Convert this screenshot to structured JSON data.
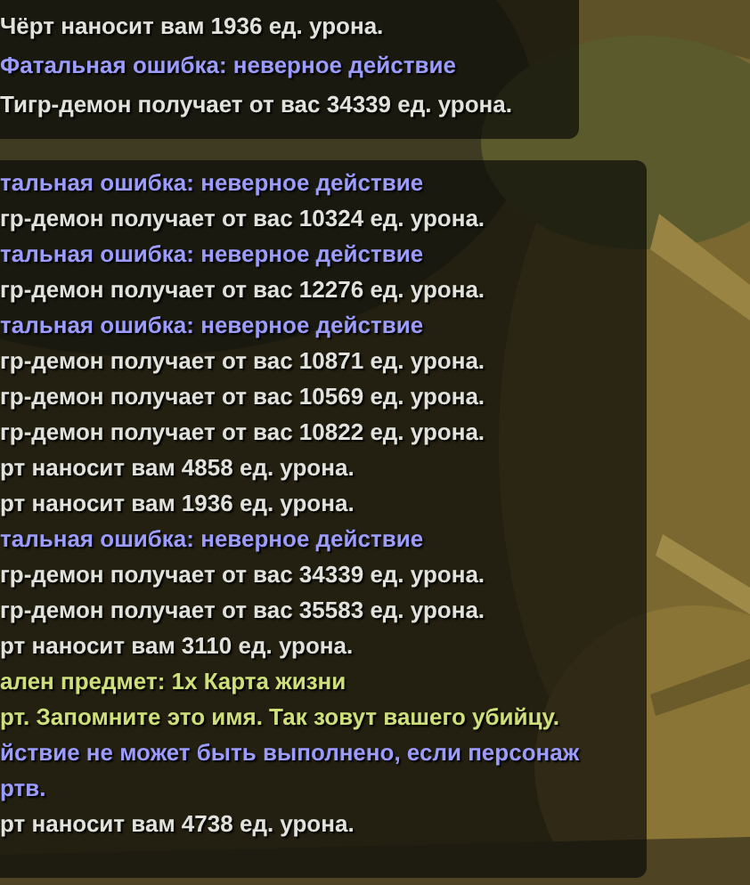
{
  "chat_panels": [
    {
      "lines": [
        {
          "kind": "normal",
          "text": "Чёрт наносит вам 1936 ед. урона."
        },
        {
          "kind": "error",
          "text": "Фатальная ошибка: неверное действие"
        },
        {
          "kind": "normal",
          "text": "Тигр-демон получает от вас 34339 ед. урона."
        }
      ]
    },
    {
      "lines": [
        {
          "kind": "error",
          "text": "тальная ошибка: неверное действие"
        },
        {
          "kind": "normal",
          "text": "гр-демон получает от вас 10324 ед. урона."
        },
        {
          "kind": "error",
          "text": "тальная ошибка: неверное действие"
        },
        {
          "kind": "normal",
          "text": "гр-демон получает от вас 12276 ед. урона."
        },
        {
          "kind": "error",
          "text": "тальная ошибка: неверное действие"
        },
        {
          "kind": "normal",
          "text": "гр-демон получает от вас 10871 ед. урона."
        },
        {
          "kind": "normal",
          "text": "гр-демон получает от вас 10569 ед. урона."
        },
        {
          "kind": "normal",
          "text": "гр-демон получает от вас 10822 ед. урона."
        },
        {
          "kind": "normal",
          "text": "рт наносит вам 4858 ед. урона."
        },
        {
          "kind": "normal",
          "text": "рт наносит вам 1936 ед. урона."
        },
        {
          "kind": "error",
          "text": "тальная ошибка: неверное действие"
        },
        {
          "kind": "normal",
          "text": "гр-демон получает от вас 34339 ед. урона."
        },
        {
          "kind": "normal",
          "text": "гр-демон получает от вас 35583 ед. урона."
        },
        {
          "kind": "normal",
          "text": "рт наносит вам 3110 ед. урона."
        },
        {
          "kind": "loot",
          "text": "ален предмет: 1х Карта жизни"
        },
        {
          "kind": "loot",
          "text": "рт. Запомните это имя. Так зовут вашего убийцу."
        },
        {
          "kind": "error",
          "text": "йствие не может быть выполнено, если персонаж"
        },
        {
          "kind": "error",
          "text": "ртв."
        },
        {
          "kind": "normal",
          "text": "рт наносит вам 4738 ед. урона."
        }
      ]
    }
  ]
}
